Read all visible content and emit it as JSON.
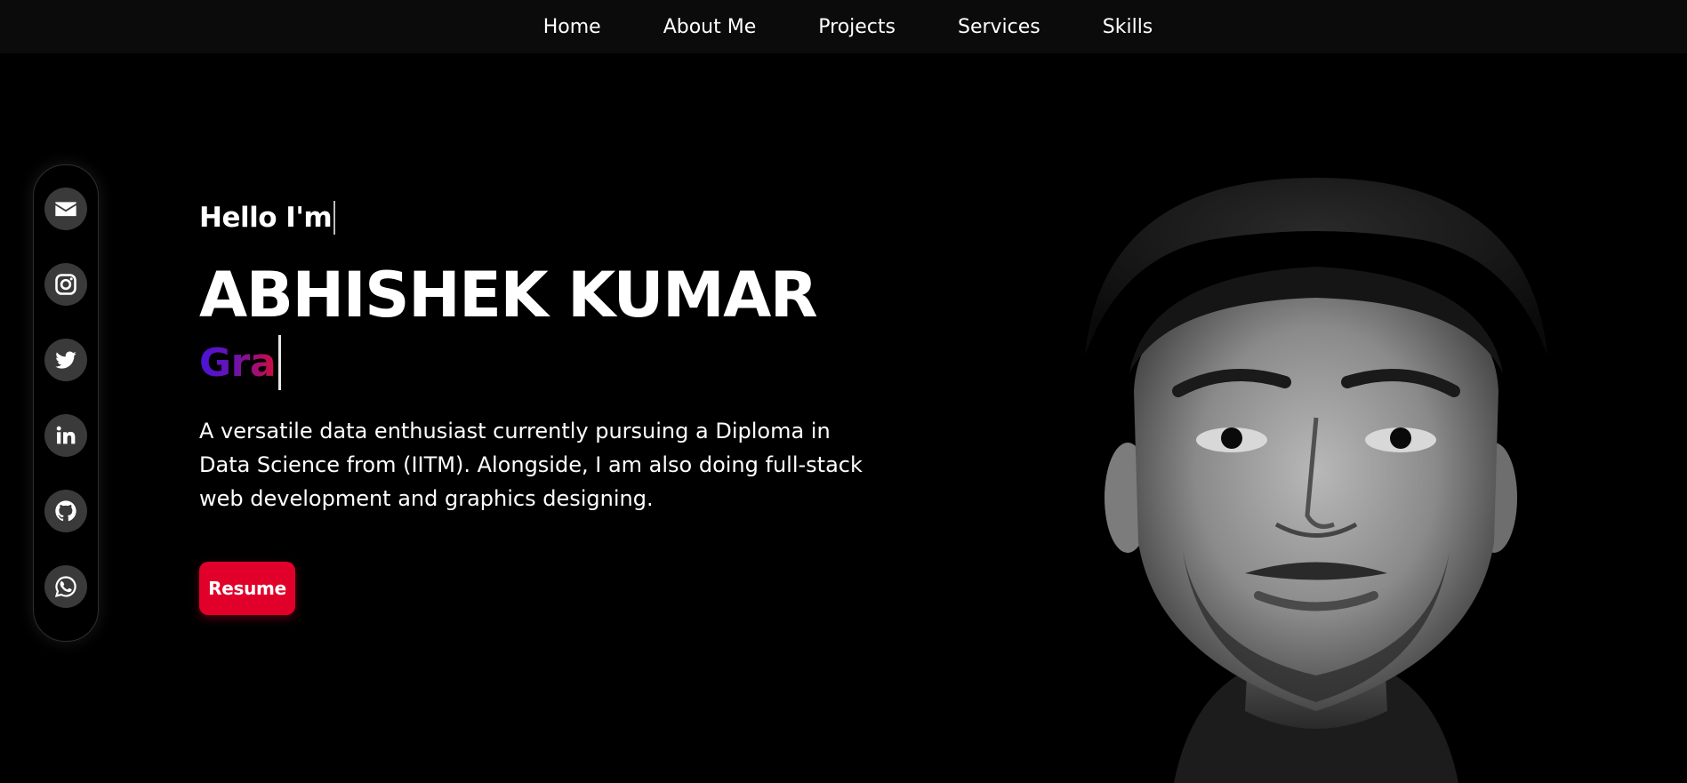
{
  "nav": {
    "items": [
      {
        "label": "Home"
      },
      {
        "label": "About Me"
      },
      {
        "label": "Projects"
      },
      {
        "label": "Services"
      },
      {
        "label": "Skills"
      }
    ]
  },
  "social": {
    "items": [
      {
        "icon": "envelope-icon"
      },
      {
        "icon": "instagram-icon"
      },
      {
        "icon": "twitter-icon"
      },
      {
        "icon": "linkedin-icon"
      },
      {
        "icon": "github-icon"
      },
      {
        "icon": "whatsapp-icon"
      }
    ]
  },
  "hero": {
    "greeting": "Hello I'm",
    "name": "ABHISHEK KUMAR",
    "typed_text": "Gra",
    "description": "A versatile data enthusiast currently pursuing a Diploma in Data Science from (IITM). Alongside, I am also doing full-stack web development and graphics designing.",
    "resume_label": "Resume"
  },
  "colors": {
    "background": "#000000",
    "navbar": "#0b0b0b",
    "accent": "#e0002a",
    "gradient_start": "#4a13d8",
    "gradient_end": "#d10c3c",
    "icon_bg": "#3a3a3a"
  }
}
